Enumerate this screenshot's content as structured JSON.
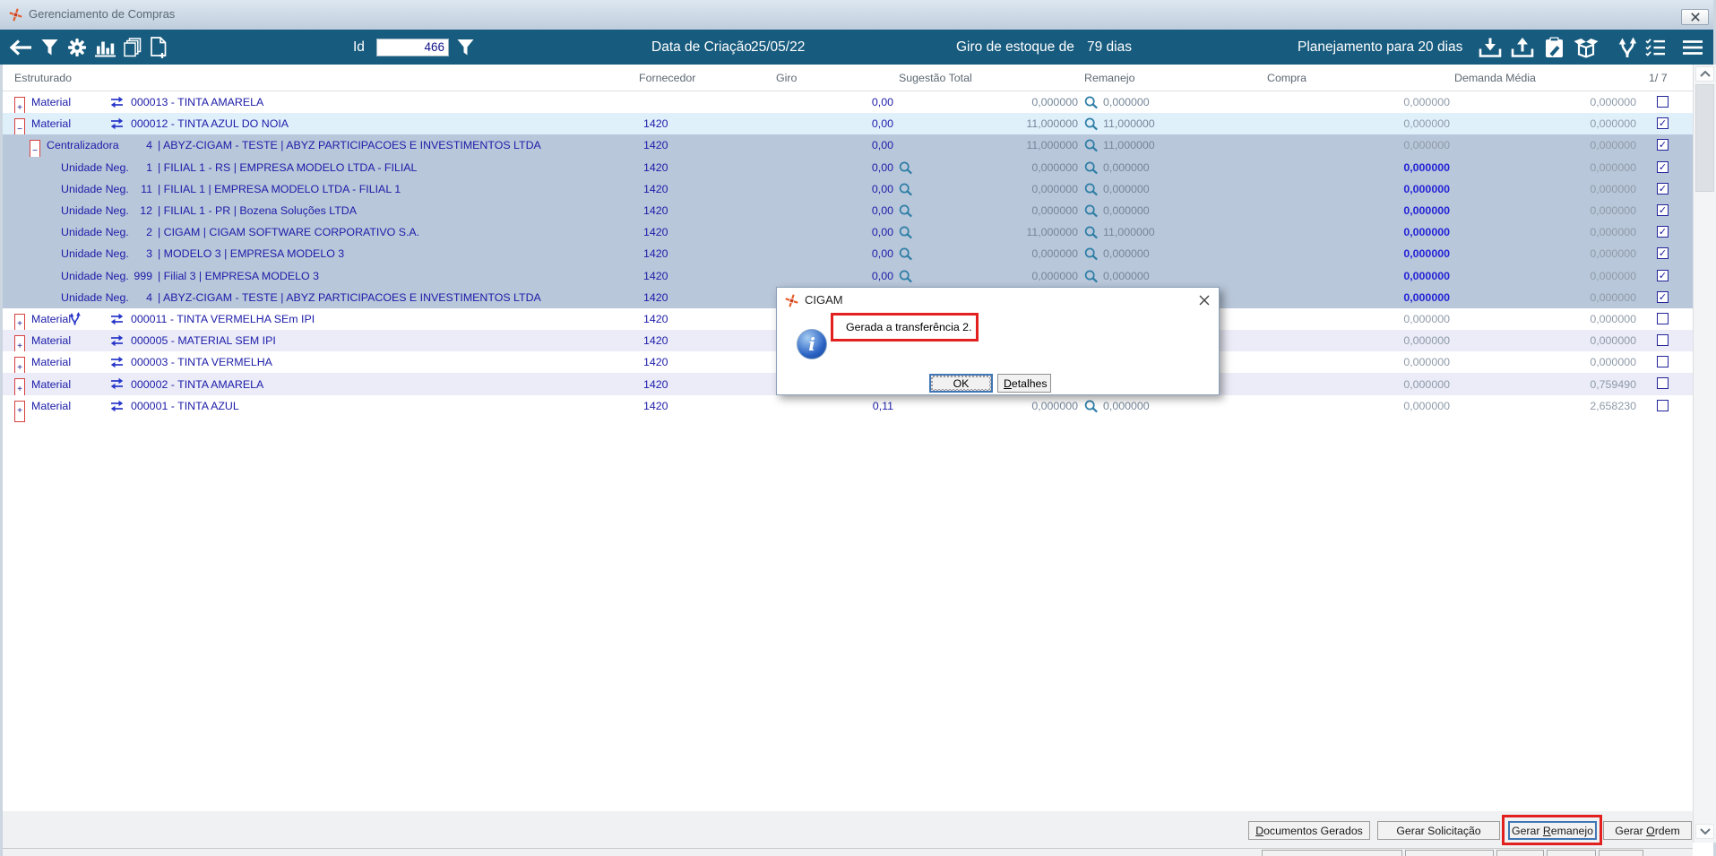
{
  "window": {
    "title": "Gerenciamento de Compras"
  },
  "toolbar": {
    "id_label": "Id",
    "id_value": "466",
    "creation_label": "Data de Criação",
    "creation_value": "25/05/22",
    "stock_label": "Giro de estoque de",
    "stock_value": "79 dias",
    "planning_label": "Planejamento para 20 dias",
    "left_icons": [
      "back",
      "filter",
      "settings",
      "bar-chart",
      "copy-documents",
      "new-document"
    ],
    "right_icons": [
      "download",
      "upload",
      "clipboard-edit",
      "package",
      "branch",
      "checklist",
      "menu"
    ]
  },
  "grid": {
    "headers": [
      "Estruturado",
      "Fornecedor",
      "Giro",
      "Sugestão Total",
      "Remanejo",
      "Compra",
      "Demanda Média"
    ],
    "page_indicator": "1/ 7",
    "rows": [
      {
        "kind": "material",
        "expand": "+",
        "label": "Material",
        "branch": false,
        "code_text": "000013 - TINTA AMARELA",
        "fornecedor": "",
        "giro": "0,00",
        "giro_mag": false,
        "sugestao": "0,000000",
        "remanejo": "0,000000",
        "compra": "0,000000",
        "compra_blue": false,
        "demanda": "0,000000",
        "checked": false,
        "bg": "white"
      },
      {
        "kind": "material",
        "expand": "-",
        "label": "Material",
        "branch": false,
        "code_text": "000012 - TINTA AZUL DO NOIA",
        "fornecedor": "1420",
        "giro": "0,00",
        "giro_mag": false,
        "sugestao": "11,000000",
        "remanejo": "11,000000",
        "compra": "0,000000",
        "compra_blue": false,
        "demanda": "0,000000",
        "checked": true,
        "bg": "blue"
      },
      {
        "kind": "central",
        "expand": "-",
        "label": "Centralizadora",
        "num": "4",
        "unit_text": "| ABYZ-CIGAM - TESTE | ABYZ PARTICIPACOES E INVESTIMENTOS LTDA",
        "fornecedor": "1420",
        "giro": "0,00",
        "giro_mag": false,
        "sugestao": "11,000000",
        "remanejo": "11,000000",
        "compra": "0,000000",
        "compra_blue": false,
        "demanda": "0,000000",
        "checked": true,
        "bg": "sel"
      },
      {
        "kind": "un",
        "label": "Unidade Neg.",
        "num": "1",
        "unit_text": "| FILIAL 1 - RS | EMPRESA MODELO LTDA - FILIAL",
        "fornecedor": "1420",
        "giro": "0,00",
        "giro_mag": true,
        "sugestao": "0,000000",
        "remanejo": "0,000000",
        "compra": "0,000000",
        "compra_blue": true,
        "demanda": "0,000000",
        "checked": true,
        "bg": "sel"
      },
      {
        "kind": "un",
        "label": "Unidade Neg.",
        "num": "11",
        "unit_text": "| FILIAL 1 | EMPRESA MODELO LTDA - FILIAL 1",
        "fornecedor": "1420",
        "giro": "0,00",
        "giro_mag": true,
        "sugestao": "0,000000",
        "remanejo": "0,000000",
        "compra": "0,000000",
        "compra_blue": true,
        "demanda": "0,000000",
        "checked": true,
        "bg": "sel"
      },
      {
        "kind": "un",
        "label": "Unidade Neg.",
        "num": "12",
        "unit_text": "| FILIAL 1 - PR | Bozena Soluções LTDA",
        "fornecedor": "1420",
        "giro": "0,00",
        "giro_mag": true,
        "sugestao": "0,000000",
        "remanejo": "0,000000",
        "compra": "0,000000",
        "compra_blue": true,
        "demanda": "0,000000",
        "checked": true,
        "bg": "sel"
      },
      {
        "kind": "un",
        "label": "Unidade Neg.",
        "num": "2",
        "unit_text": "| CIGAM | CIGAM SOFTWARE CORPORATIVO S.A.",
        "fornecedor": "1420",
        "giro": "0,00",
        "giro_mag": true,
        "sugestao": "11,000000",
        "remanejo": "11,000000",
        "compra": "0,000000",
        "compra_blue": true,
        "demanda": "0,000000",
        "checked": true,
        "bg": "sel"
      },
      {
        "kind": "un",
        "label": "Unidade Neg.",
        "num": "3",
        "unit_text": "| MODELO 3 | EMPRESA MODELO 3",
        "fornecedor": "1420",
        "giro": "0,00",
        "giro_mag": true,
        "sugestao": "0,000000",
        "remanejo": "0,000000",
        "compra": "0,000000",
        "compra_blue": true,
        "demanda": "0,000000",
        "checked": true,
        "bg": "sel"
      },
      {
        "kind": "un",
        "label": "Unidade Neg.",
        "num": "999",
        "unit_text": "| Filial 3 | EMPRESA MODELO 3",
        "fornecedor": "1420",
        "giro": "0,00",
        "giro_mag": true,
        "sugestao": "0,000000",
        "remanejo": "0,000000",
        "compra": "0,000000",
        "compra_blue": true,
        "demanda": "0,000000",
        "checked": true,
        "bg": "sel"
      },
      {
        "kind": "un",
        "label": "Unidade Neg.",
        "num": "4",
        "unit_text": "| ABYZ-CIGAM - TESTE | ABYZ PARTICIPACOES E INVESTIMENTOS LTDA",
        "fornecedor": "1420",
        "giro": null,
        "giro_mag": false,
        "sugestao": null,
        "remanejo": null,
        "compra": "0,000000",
        "compra_blue": true,
        "demanda": "0,000000",
        "checked": true,
        "bg": "sel"
      },
      {
        "kind": "material",
        "expand": "+",
        "label": "Material",
        "branch": true,
        "code_text": "000011 - TINTA VERMELHA SEm IPI",
        "fornecedor": "1420",
        "giro": null,
        "giro_mag": false,
        "sugestao": null,
        "remanejo": null,
        "compra": "0,000000",
        "compra_blue": false,
        "demanda": "0,000000",
        "checked": false,
        "bg": "white"
      },
      {
        "kind": "material",
        "expand": "+",
        "label": "Material",
        "branch": false,
        "code_text": "000005 - MATERIAL SEM IPI",
        "fornecedor": "1420",
        "giro": null,
        "giro_mag": false,
        "sugestao": null,
        "remanejo": null,
        "compra": "0,000000",
        "compra_blue": false,
        "demanda": "0,000000",
        "checked": false,
        "bg": "lav"
      },
      {
        "kind": "material",
        "expand": "+",
        "label": "Material",
        "branch": false,
        "code_text": "000003 - TINTA VERMELHA",
        "fornecedor": "1420",
        "giro": null,
        "giro_mag": false,
        "sugestao": null,
        "remanejo": null,
        "compra": "0,000000",
        "compra_blue": false,
        "demanda": "0,000000",
        "checked": false,
        "bg": "white"
      },
      {
        "kind": "material",
        "expand": "+",
        "label": "Material",
        "branch": false,
        "code_text": "000002 - TINTA AMARELA",
        "fornecedor": "1420",
        "giro": null,
        "giro_mag": false,
        "sugestao": null,
        "remanejo": null,
        "compra": "0,000000",
        "compra_blue": false,
        "demanda": "0,759490",
        "checked": false,
        "bg": "lav"
      },
      {
        "kind": "material",
        "expand": "+",
        "label": "Material",
        "branch": false,
        "code_text": "000001 - TINTA AZUL",
        "fornecedor": "1420",
        "giro": "0,11",
        "giro_mag": false,
        "sugestao": "0,000000",
        "remanejo": "0,000000",
        "compra": "0,000000",
        "compra_blue": false,
        "demanda": "2,658230",
        "checked": false,
        "bg": "white"
      }
    ]
  },
  "dialog": {
    "title": "CIGAM",
    "message": "Gerada a transferência 2.",
    "ok_label": "OK",
    "details_u": "D",
    "details_post": "etalhes"
  },
  "footer": {
    "buttons": [
      {
        "name": "documentos-gerados",
        "pre": "",
        "u": "D",
        "post": "ocumentos Gerados",
        "highlight": false
      },
      {
        "name": "gerar-solicitacao",
        "pre": "Gerar Solicitação",
        "u": "",
        "post": "",
        "highlight": false
      },
      {
        "name": "gerar-remanejo",
        "pre": "Gerar ",
        "u": "R",
        "post": "emanejo",
        "highlight": true
      },
      {
        "name": "gerar-ordem",
        "pre": "Gerar ",
        "u": "O",
        "post": "rdem",
        "highlight": false
      }
    ]
  },
  "colors": {
    "toolbar": "#175b7e",
    "selection_row": "#b9c7da",
    "annotation_red": "#e32020",
    "navy_text": "#1c1ca8",
    "magnifier": "#2e7ea6"
  }
}
